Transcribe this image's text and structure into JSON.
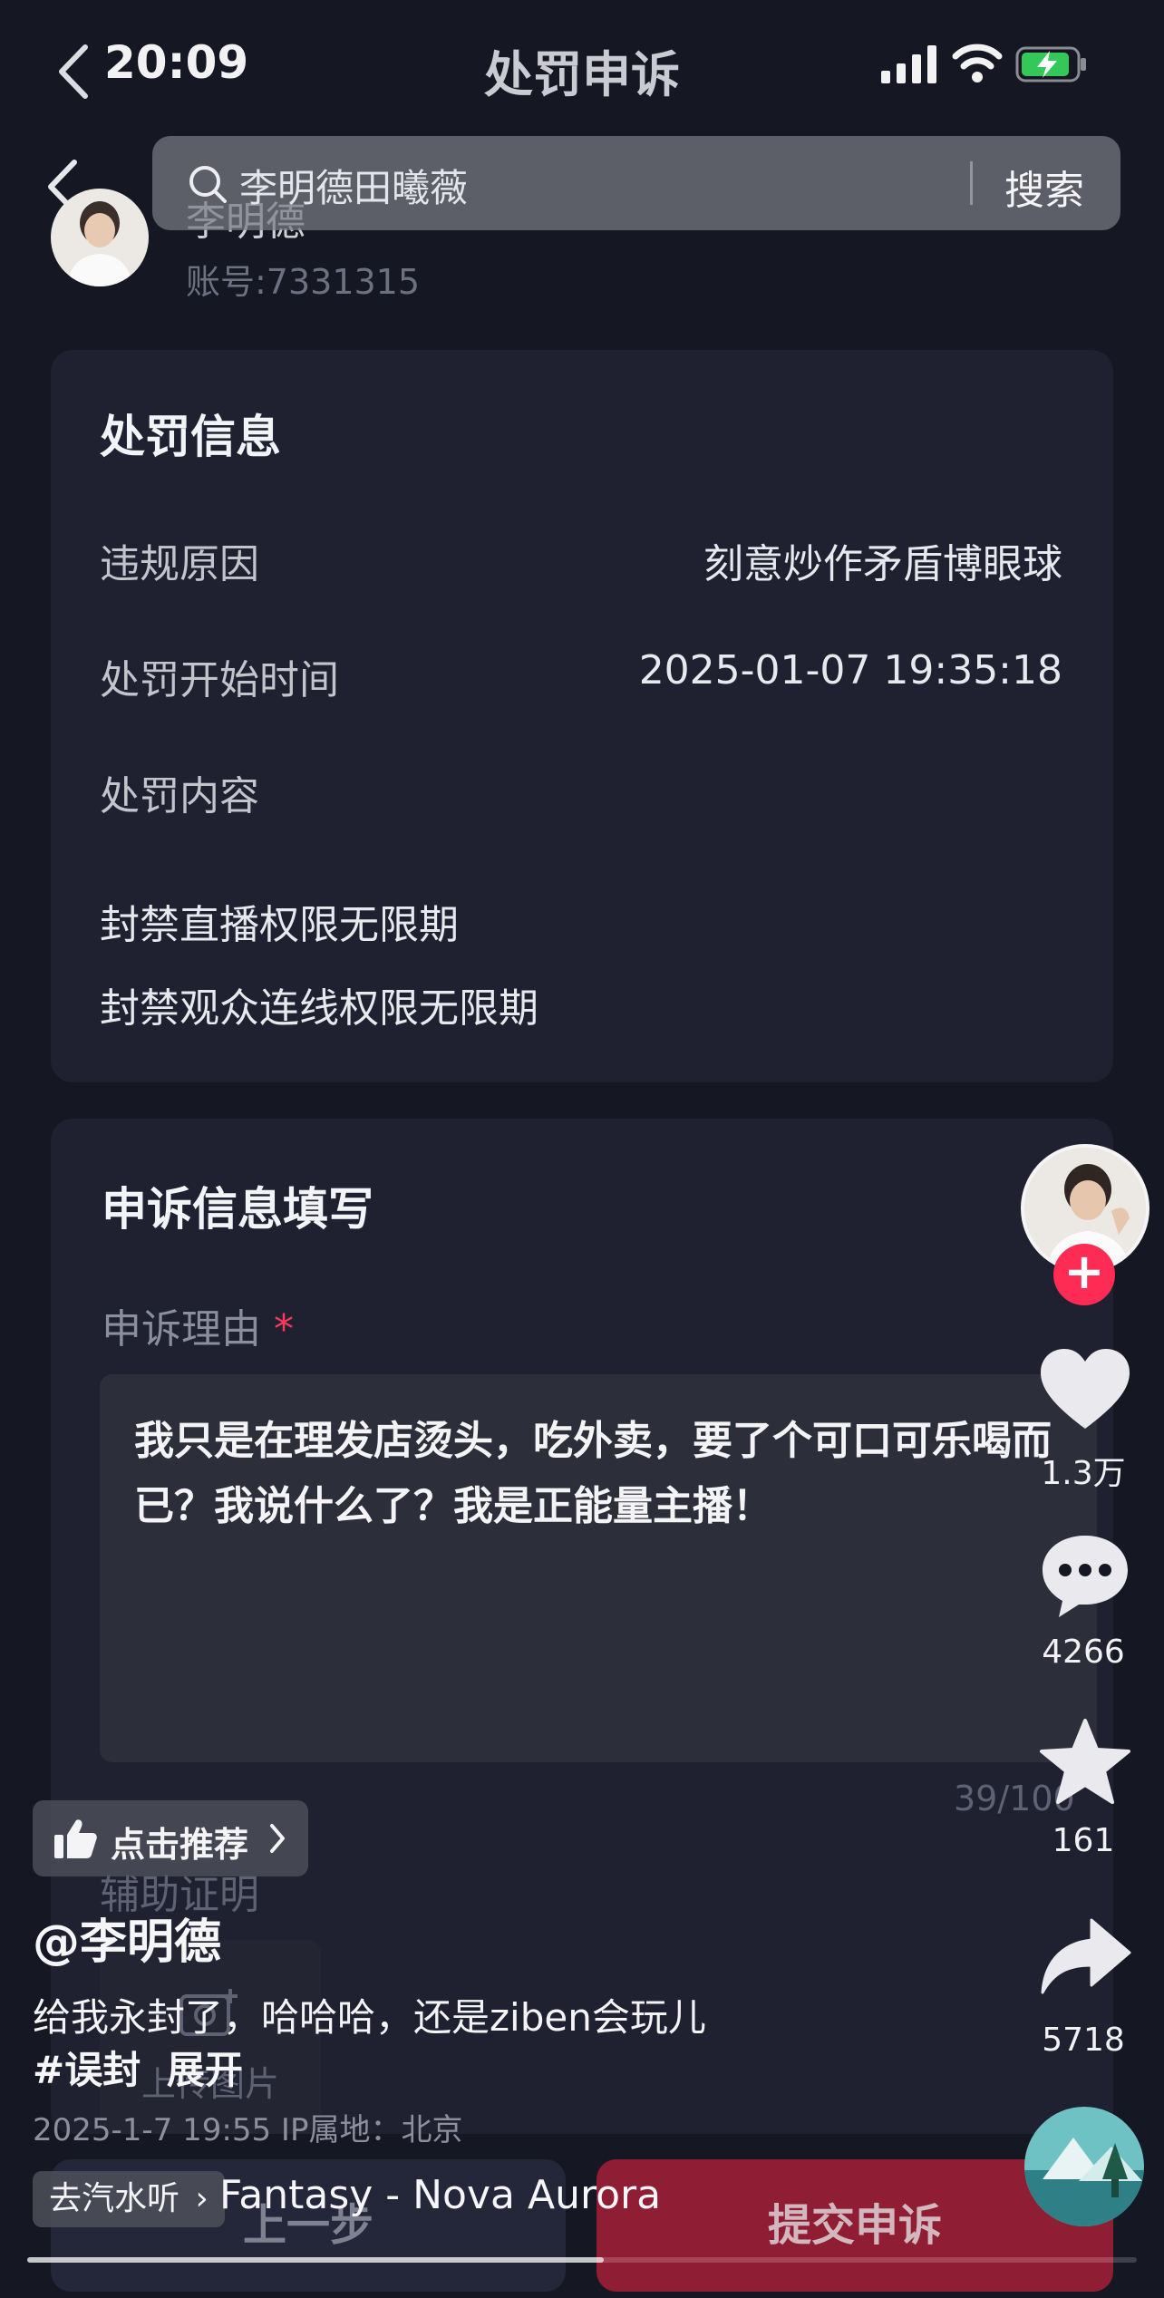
{
  "status_bar": {
    "time": "20:09",
    "title": "处罚申诉"
  },
  "profile": {
    "name": "李明德",
    "account": "账号:7331315"
  },
  "search": {
    "query": "李明德田曦薇",
    "button": "搜索"
  },
  "penalty": {
    "title": "处罚信息",
    "rows": [
      {
        "label": "违规原因",
        "value": "刻意炒作矛盾博眼球"
      },
      {
        "label": "处罚开始时间",
        "value": "2025-01-07 19:35:18"
      }
    ],
    "content_label": "处罚内容",
    "content_items": [
      "封禁直播权限无限期",
      "封禁观众连线权限无限期"
    ]
  },
  "appeal": {
    "title": "申诉信息填写",
    "reason_label": "申诉理由",
    "required_mark": "*",
    "reason_text": "我只是在理发店烫头，吃外卖，要了个可口可乐喝而已？我说什么了？我是正能量主播！",
    "char_count": "39/100",
    "aux_label": "辅助证明",
    "upload_label": "上传图片"
  },
  "buttons": {
    "prev": "上一步",
    "submit": "提交申诉"
  },
  "rail": {
    "follow_symbol": "+",
    "likes": "1.3万",
    "comments": "4266",
    "favorites": "161",
    "shares": "5718"
  },
  "overlay": {
    "recommend": "点击推荐",
    "author": "@李明德",
    "caption": "给我永封了，哈哈哈，还是ziben会玩儿",
    "hashtag": "#误封",
    "expand": "展开",
    "meta": "2025-1-7 19:55  IP属地：北京",
    "music_tag": "去汽水听",
    "music_title": "Fantasy - Nova Aurora",
    "progress": 0.52
  },
  "colors": {
    "accent": "#fe2c55",
    "background": "#151722",
    "card": "#1f2130"
  }
}
